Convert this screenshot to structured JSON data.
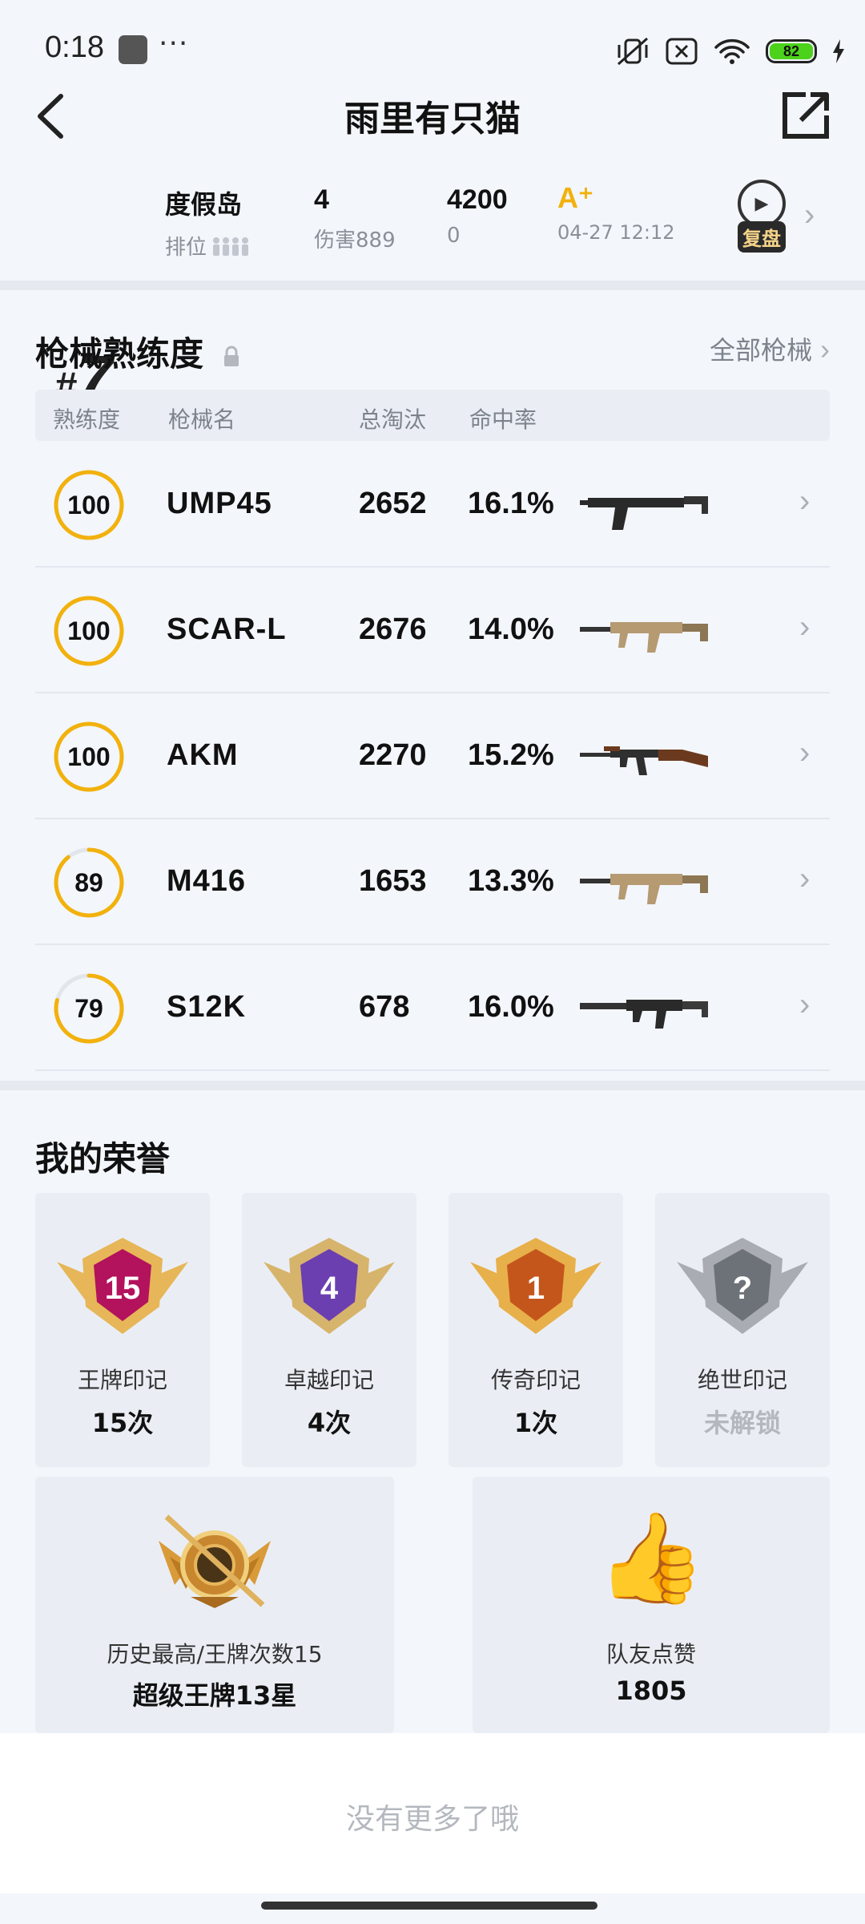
{
  "status_bar": {
    "time": "0:18",
    "dots": "···",
    "battery": "82"
  },
  "header": {
    "title": "雨里有只猫"
  },
  "match": {
    "rank_hash": "#",
    "rank_num": "7",
    "map": "度假岛",
    "rank_label": "排位",
    "kills": "4",
    "damage": "伤害889",
    "score": "4200",
    "score_change": "0",
    "grade": "A⁺",
    "time": "04-27 12:12",
    "replay": "复盘"
  },
  "weapons": {
    "title": "枪械熟练度",
    "all_link": "全部枪械",
    "headers": [
      "熟练度",
      "枪械名",
      "总淘汰",
      "命中率"
    ],
    "rows": [
      {
        "mastery": "100",
        "level": 1.0,
        "name": "UMP45",
        "kills": "2652",
        "accuracy": "16.1%",
        "gun_icon": "smg-icon"
      },
      {
        "mastery": "100",
        "level": 1.0,
        "name": "SCAR-L",
        "kills": "2676",
        "accuracy": "14.0%",
        "gun_icon": "rifle-icon"
      },
      {
        "mastery": "100",
        "level": 1.0,
        "name": "AKM",
        "kills": "2270",
        "accuracy": "15.2%",
        "gun_icon": "akm-icon"
      },
      {
        "mastery": "89",
        "level": 0.89,
        "name": "M416",
        "kills": "1653",
        "accuracy": "13.3%",
        "gun_icon": "rifle-icon"
      },
      {
        "mastery": "79",
        "level": 0.79,
        "name": "S12K",
        "kills": "678",
        "accuracy": "16.0%",
        "gun_icon": "shotgun-icon"
      }
    ]
  },
  "honors": {
    "title": "我的荣誉",
    "marks": [
      {
        "label": "王牌印记",
        "value": "15次",
        "badge": "15"
      },
      {
        "label": "卓越印记",
        "value": "4次",
        "badge": "4"
      },
      {
        "label": "传奇印记",
        "value": "1次",
        "badge": "1"
      },
      {
        "label": "绝世印记",
        "value": "未解锁",
        "badge": "?"
      }
    ],
    "best": {
      "label": "历史最高/王牌次数15",
      "value": "超级王牌13星"
    },
    "likes": {
      "label": "队友点赞",
      "value": "1805"
    }
  },
  "footer": {
    "text": "没有更多了哦"
  },
  "colors": {
    "accent": "#f2b10c",
    "background": "#f3f6fb",
    "card": "#eaeef4"
  }
}
